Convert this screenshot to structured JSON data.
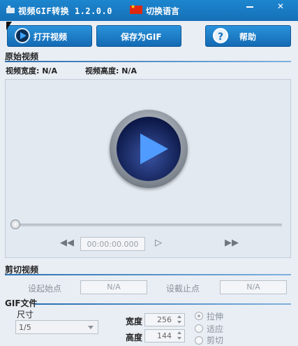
{
  "titlebar": {
    "title": "视频GIF转换 1.2.0.0",
    "lang_button": "切换语言",
    "icons": [
      "app-icon",
      "china-flag-icon",
      "minimize-icon",
      "close-icon"
    ]
  },
  "toolbar": {
    "open_label": "打开视频",
    "save_label": "保存为GIF",
    "help_label": "帮助",
    "help_glyph": "?"
  },
  "original": {
    "section_title": "原始视频",
    "width_label": "视频宽度: N/A",
    "height_label": "视频高度: N/A"
  },
  "player": {
    "time": "00:00:00.000",
    "icons": [
      "big-play-icon",
      "rewind-icon",
      "step-icon",
      "fast-forward-icon"
    ]
  },
  "clip": {
    "section_title": "剪切视频",
    "start_label": "设起始点",
    "start_value": "N/A",
    "end_label": "设截止点",
    "end_value": "N/A"
  },
  "gif": {
    "section_title": "GIF文件",
    "size_label": "尺寸",
    "size_value": "1/5",
    "width_label": "宽度",
    "width_value": "256",
    "height_label": "高度",
    "height_value": "144",
    "stretch_label": "拉伸",
    "fit_label": "适应",
    "crop_label": "剪切"
  },
  "colors": {
    "accent": "#1670b7",
    "panel": "#e3e9f1"
  }
}
